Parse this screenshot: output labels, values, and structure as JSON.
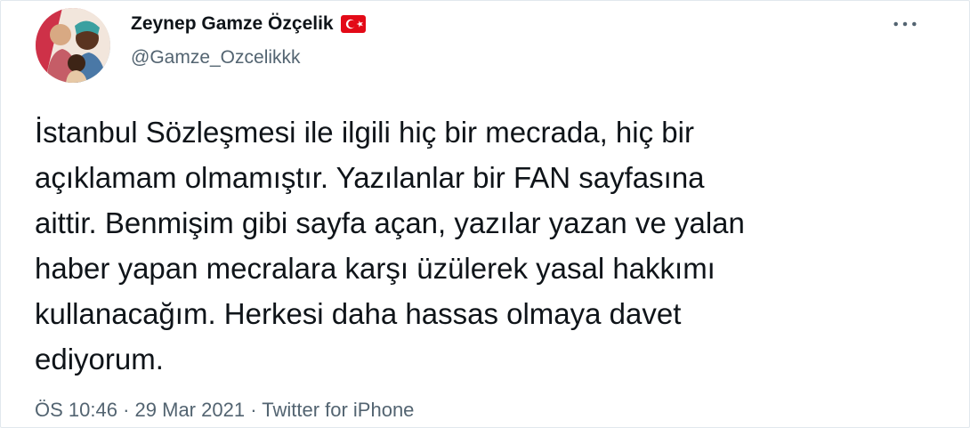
{
  "tweet": {
    "author": {
      "display_name": "Zeynep Gamze Özçelik",
      "handle": "@Gamze_Ozcelikkk",
      "flag_icon": "turkey-flag-icon"
    },
    "text": "İstanbul Sözleşmesi ile ilgili hiç bir mecrada, hiç bir\naçıklamam olmamıştır. Yazılanlar bir FAN sayfasına\naittir. Benmişim gibi sayfa açan, yazılar yazan ve yalan\nhaber yapan mecralara karşı üzülerek yasal hakkımı\nkullanacağım. Herkesi daha hassas olmaya davet\nediyorum.",
    "time": "ÖS 10:46",
    "date": "29 Mar 2021",
    "source": "Twitter for iPhone",
    "separator": "·"
  },
  "icons": {
    "more": "more-options-icon"
  },
  "colors": {
    "text": "#0f1419",
    "secondary": "#536471",
    "flag_red": "#e30a17",
    "border": "#e1e8ed"
  }
}
